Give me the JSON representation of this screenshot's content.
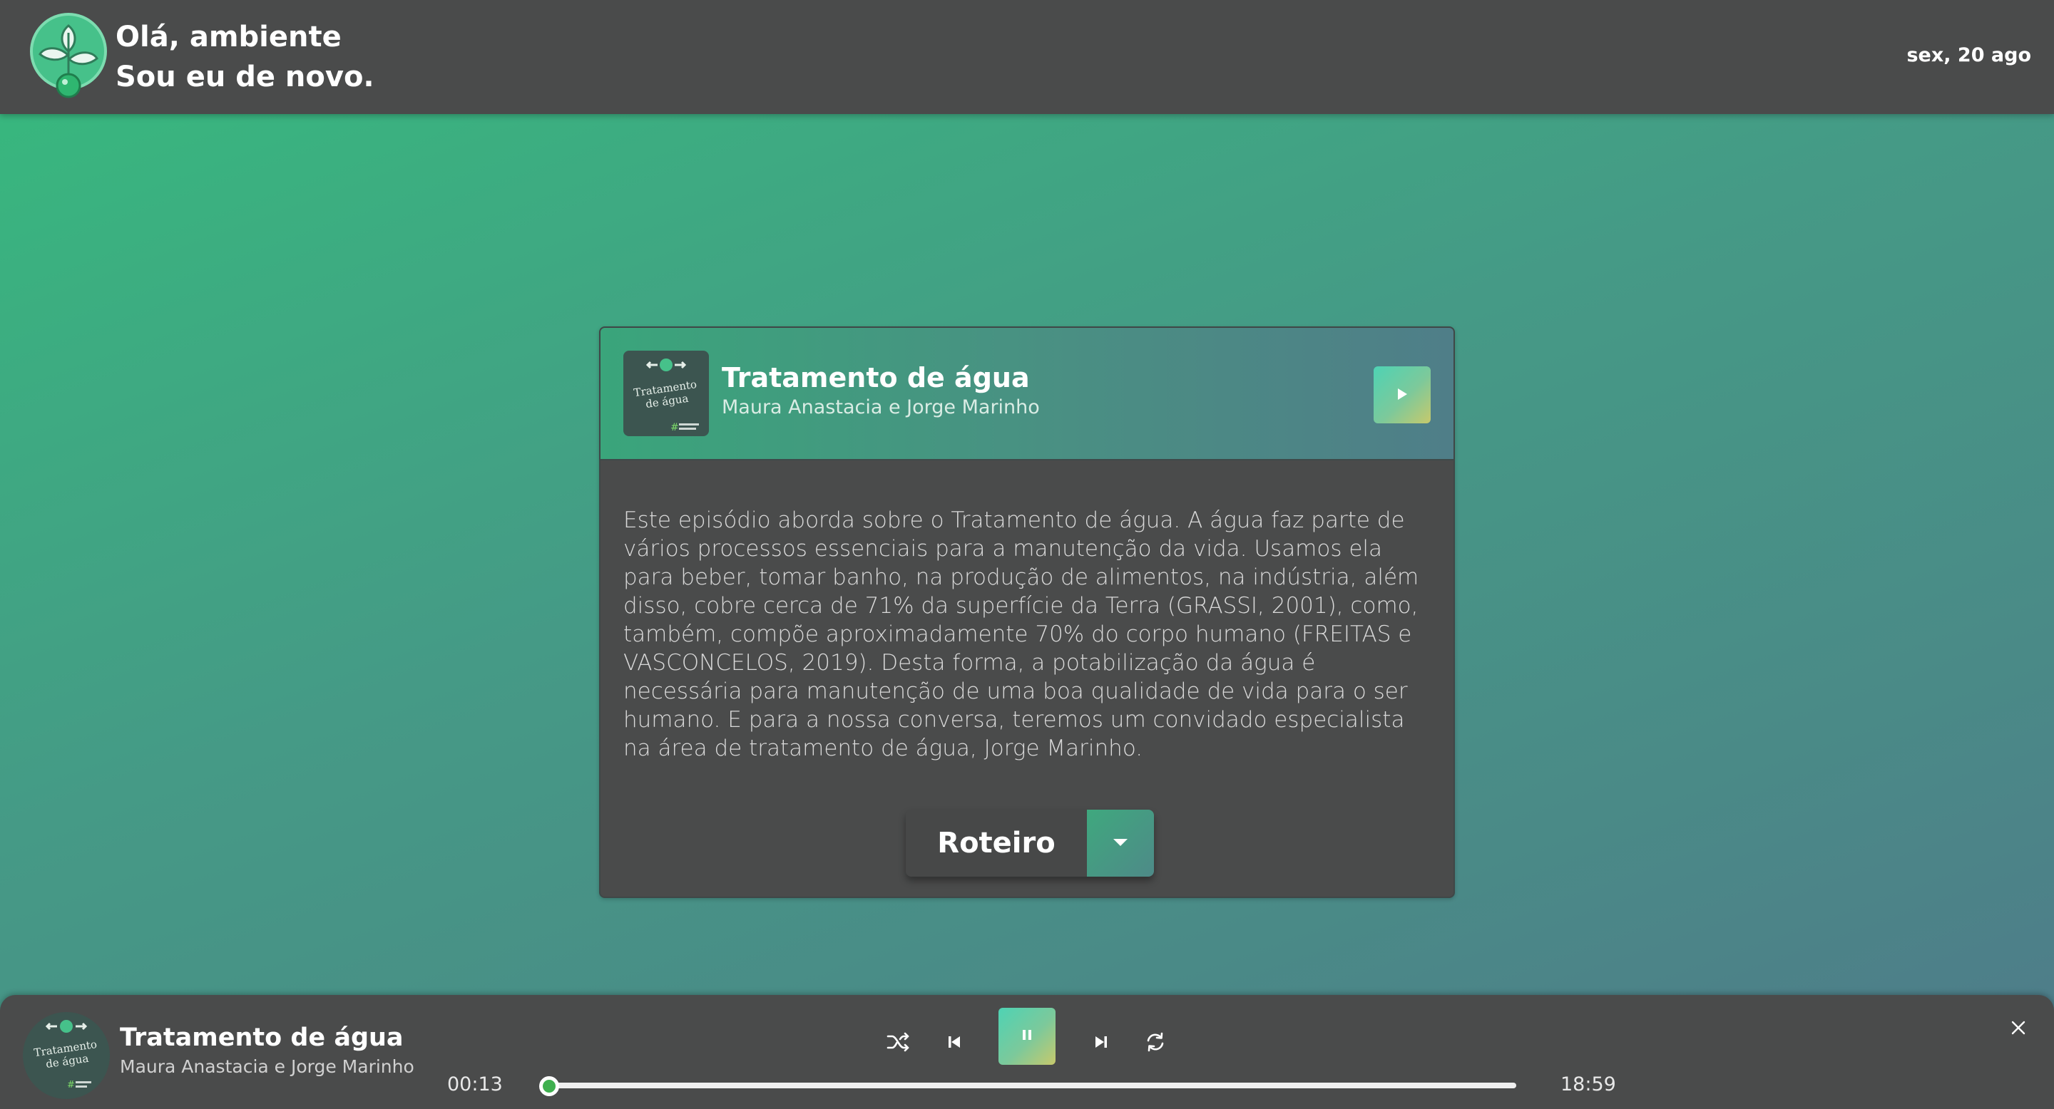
{
  "header": {
    "greeting_line1": "Olá, ambiente",
    "greeting_line2": "Sou eu de novo.",
    "date": "sex, 20 ago",
    "logo_icon": "plant-bulb-icon"
  },
  "episode": {
    "title": "Tratamento de água",
    "authors": "Maura Anastacia e Jorge Marinho",
    "cover_text_line1": "Tratamento",
    "cover_text_line2": "de água",
    "description": "Este episódio aborda sobre o Tratamento de água. A água faz parte de vários processos essenciais para a manutenção da vida. Usamos ela para beber, tomar banho, na produção de alimentos, na indústria, além disso, cobre cerca de 71% da superfície da Terra (GRASSI, 2001), como, também, compõe aproximadamente 70% do corpo humano (FREITAS e VASCONCELOS, 2019). Desta forma, a potabilização da água é necessária para manutenção de uma boa qualidade de vida para o ser humano. E para a nossa conversa, teremos um convidado especialista na área de tratamento de água, Jorge Marinho.",
    "play_icon": "play-icon",
    "roteiro_label": "Roteiro",
    "roteiro_icon": "caret-down-icon"
  },
  "player": {
    "title": "Tratamento de água",
    "authors": "Maura Anastacia e Jorge Marinho",
    "current_time": "00:13",
    "total_time": "18:59",
    "progress": 0.012,
    "controls": [
      "shuffle-icon",
      "previous-icon",
      "pause-icon",
      "next-icon",
      "repeat-icon"
    ],
    "close_icon": "close-icon"
  },
  "colors": {
    "bar_background": "#4a4b4b",
    "accent_green": "#36bb7d",
    "accent_gradient_start": "#4ed3b4",
    "accent_gradient_end": "#c7c96c"
  }
}
